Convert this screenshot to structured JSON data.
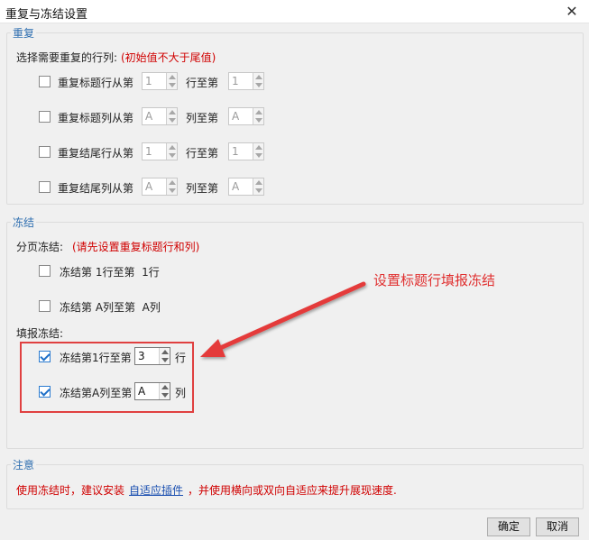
{
  "window": {
    "title": "重复与冻结设置"
  },
  "repeat": {
    "group_label": "重复",
    "prompt": "选择需要重复的行列:",
    "prompt_note": "(初始值不大于尾值)",
    "rows": [
      {
        "label": "重复标题行从第",
        "from": "1",
        "mid": "行至第",
        "to": "1"
      },
      {
        "label": "重复标题列从第",
        "from": "A",
        "mid": "列至第",
        "to": "A"
      },
      {
        "label": "重复结尾行从第",
        "from": "1",
        "mid": "行至第",
        "to": "1"
      },
      {
        "label": "重复结尾列从第",
        "from": "A",
        "mid": "列至第",
        "to": "A"
      }
    ]
  },
  "freeze": {
    "group_label": "冻结",
    "page_prompt": "分页冻结:",
    "page_note": "(请先设置重复标题行和列)",
    "page_items": [
      {
        "label": "冻结第 1行至第  1行",
        "checked": false
      },
      {
        "label": "冻结第 A列至第  A列",
        "checked": false
      }
    ],
    "fill_prompt": "填报冻结:",
    "fill_items": [
      {
        "prefix": "冻结第1行至第",
        "value": "3",
        "suffix": "行",
        "checked": true
      },
      {
        "prefix": "冻结第A列至第",
        "value": "A",
        "suffix": "列",
        "checked": true
      }
    ]
  },
  "annotation": "设置标题行填报冻结",
  "note": {
    "group_label": "注意",
    "text_before": "使用冻结时，建议安装",
    "link": "自适应插件",
    "text_after": "，并使用横向或双向自适应来提升展现速度."
  },
  "buttons": {
    "ok": "确定",
    "cancel": "取消"
  },
  "colors": {
    "accent": "#2f6fb0",
    "warning": "#d00000",
    "annotation": "#e03030"
  }
}
